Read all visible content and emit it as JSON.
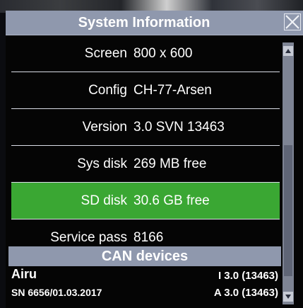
{
  "window": {
    "title": "System Information"
  },
  "info_rows": [
    {
      "label": "Screen",
      "value": "800 x 600"
    },
    {
      "label": "Config",
      "value": "CH-77-Arsen"
    },
    {
      "label": "Version",
      "value": "3.0 SVN 13463"
    },
    {
      "label": "Sys disk",
      "value": "269 MB free"
    },
    {
      "label": "SD disk",
      "value": "30.6 GB free",
      "selected": true
    },
    {
      "label": "Service pass",
      "value": "8166"
    }
  ],
  "can_section": {
    "title": "CAN devices",
    "device": {
      "name": "Airu",
      "serial": "SN 6656/01.03.2017",
      "fw_i": "I 3.0 (13463)",
      "fw_a": "A 3.0 (13463)"
    }
  },
  "icons": {
    "close": "close-icon",
    "scroll_up": "triangle-up-icon",
    "scroll_down": "triangle-down-icon"
  },
  "colors": {
    "titlebar": "#8f98ad",
    "selected_row": "#3aa733",
    "background": "#050505",
    "text": "#ffffff"
  }
}
